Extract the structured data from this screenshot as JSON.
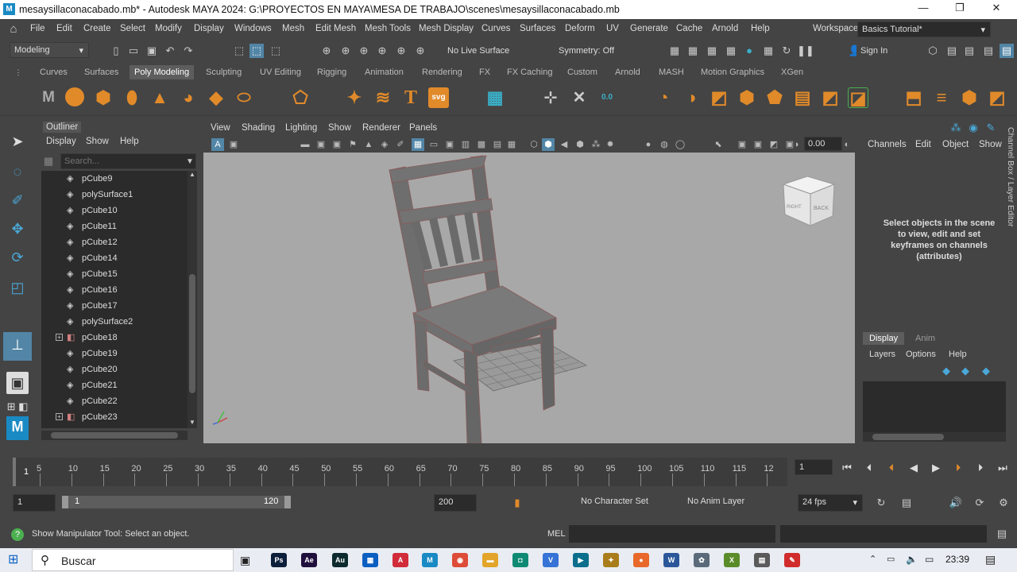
{
  "window": {
    "title": "mesaysillaconacabado.mb* - Autodesk MAYA 2024: G:\\PROYECTOS EN MAYA\\MESA DE TRABAJO\\scenes\\mesaysillaconacabado.mb",
    "app_icon": "M",
    "minimize": "—",
    "restore": "❐",
    "close": "✕"
  },
  "menubar": {
    "items": [
      "File",
      "Edit",
      "Create",
      "Select",
      "Modify",
      "Display",
      "Windows",
      "Mesh",
      "Edit Mesh",
      "Mesh Tools",
      "Mesh Display",
      "Curves",
      "Surfaces",
      "Deform",
      "UV",
      "Generate",
      "Cache",
      "Arnold",
      "Help"
    ],
    "workspace_label": "Workspace:",
    "workspace_value": "Basics Tutorial*"
  },
  "statusline": {
    "mode": "Modeling",
    "live_surface": "No Live Surface",
    "symmetry": "Symmetry: Off",
    "sign_in": "Sign In"
  },
  "shelf": {
    "tabs": [
      "Curves",
      "Surfaces",
      "Poly Modeling",
      "Sculpting",
      "UV Editing",
      "Rigging",
      "Animation",
      "Rendering",
      "FX",
      "FX Caching",
      "Custom",
      "Arnold",
      "MASH",
      "Motion Graphics",
      "XGen"
    ],
    "selected": "Poly Modeling",
    "text_tool": "T",
    "svg_tool": "svg",
    "snow_value": "0.0"
  },
  "outliner": {
    "title": "Outliner",
    "menus": [
      "Display",
      "Show",
      "Help"
    ],
    "search_placeholder": "Search...",
    "items": [
      {
        "name": "pCube9",
        "expandable": false,
        "icon": "mesh-icon"
      },
      {
        "name": "polySurface1",
        "expandable": false,
        "icon": "mesh-icon"
      },
      {
        "name": "pCube10",
        "expandable": false,
        "icon": "mesh-icon"
      },
      {
        "name": "pCube11",
        "expandable": false,
        "icon": "mesh-icon"
      },
      {
        "name": "pCube12",
        "expandable": false,
        "icon": "mesh-icon"
      },
      {
        "name": "pCube14",
        "expandable": false,
        "icon": "mesh-icon"
      },
      {
        "name": "pCube15",
        "expandable": false,
        "icon": "mesh-icon"
      },
      {
        "name": "pCube16",
        "expandable": false,
        "icon": "mesh-icon"
      },
      {
        "name": "pCube17",
        "expandable": false,
        "icon": "mesh-icon"
      },
      {
        "name": "polySurface2",
        "expandable": false,
        "icon": "mesh-icon"
      },
      {
        "name": "pCube18",
        "expandable": true,
        "icon": "group-icon"
      },
      {
        "name": "pCube19",
        "expandable": false,
        "icon": "mesh-icon"
      },
      {
        "name": "pCube20",
        "expandable": false,
        "icon": "mesh-icon"
      },
      {
        "name": "pCube21",
        "expandable": false,
        "icon": "mesh-icon"
      },
      {
        "name": "pCube22",
        "expandable": false,
        "icon": "mesh-icon"
      },
      {
        "name": "pCube23",
        "expandable": true,
        "icon": "group-icon"
      }
    ]
  },
  "viewport": {
    "menus": [
      "View",
      "Shading",
      "Lighting",
      "Show",
      "Renderer",
      "Panels"
    ],
    "exposure": "0.00",
    "viewcube_right": "RIGHT",
    "viewcube_back": "BACK"
  },
  "channelbox": {
    "menus": [
      "Channels",
      "Edit",
      "Object",
      "Show"
    ],
    "message": "Select objects in the scene to view, edit and set keyframes on channels (attributes)",
    "sidebar_label": "Channel Box / Layer Editor",
    "tabs": [
      "Display",
      "Anim"
    ],
    "layer_menus": [
      "Layers",
      "Options",
      "Help"
    ]
  },
  "timeline": {
    "ticks": [
      "5",
      "10",
      "15",
      "20",
      "25",
      "30",
      "35",
      "40",
      "45",
      "50",
      "55",
      "60",
      "65",
      "70",
      "75",
      "80",
      "85",
      "90",
      "95",
      "100",
      "105",
      "110",
      "115",
      "12"
    ],
    "start_label": "1",
    "current_frame": "1"
  },
  "range": {
    "start": "1",
    "inner_start": "1",
    "inner_end": "120",
    "end": "200",
    "char_set": "No Character Set",
    "anim_layer": "No Anim Layer",
    "fps": "24 fps"
  },
  "cmdline": {
    "help_text": "Show Manipulator Tool: Select an object.",
    "mel_label": "MEL"
  },
  "taskbar": {
    "search_label": "Buscar",
    "time": "23:39",
    "apps": [
      {
        "label": "Ps",
        "color": "#0b1e3a",
        "name": "photoshop-icon"
      },
      {
        "label": "Ae",
        "color": "#1f0f3d",
        "name": "after-effects-icon"
      },
      {
        "label": "Au",
        "color": "#0c2a2f",
        "name": "audition-icon"
      },
      {
        "label": "▦",
        "color": "#0b5fc1",
        "name": "calculator-icon"
      },
      {
        "label": "A",
        "color": "#d02c3a",
        "name": "acrobat-icon"
      },
      {
        "label": "M",
        "color": "#1a8ac4",
        "name": "maya-icon"
      },
      {
        "label": "◉",
        "color": "#dd4b39",
        "name": "chrome-icon"
      },
      {
        "label": "▬",
        "color": "#e2a529",
        "name": "file-explorer-icon"
      },
      {
        "label": "◘",
        "color": "#0e8a74",
        "name": "whatsapp-icon"
      },
      {
        "label": "V",
        "color": "#3673d6",
        "name": "vscode-icon"
      },
      {
        "label": "▶",
        "color": "#0a6e8c",
        "name": "terminal-icon"
      },
      {
        "label": "✦",
        "color": "#a97d1b",
        "name": "app-icon"
      },
      {
        "label": "●",
        "color": "#e8692a",
        "name": "firefox-icon"
      },
      {
        "label": "W",
        "color": "#2b579a",
        "name": "word-icon"
      },
      {
        "label": "✿",
        "color": "#5a6a7a",
        "name": "steam-icon"
      },
      {
        "label": "X",
        "color": "#5b8c2a",
        "name": "xnview-icon"
      },
      {
        "label": "▤",
        "color": "#5a5a5a",
        "name": "clapper-icon"
      },
      {
        "label": "✎",
        "color": "#d02c2c",
        "name": "paint-icon"
      }
    ]
  },
  "colors": {
    "panel": "#444444",
    "field": "#2b2b2b",
    "viewport_bg": "#a8a8a8",
    "accent": "#5285a6",
    "shelf_orange": "#e08a2a"
  }
}
